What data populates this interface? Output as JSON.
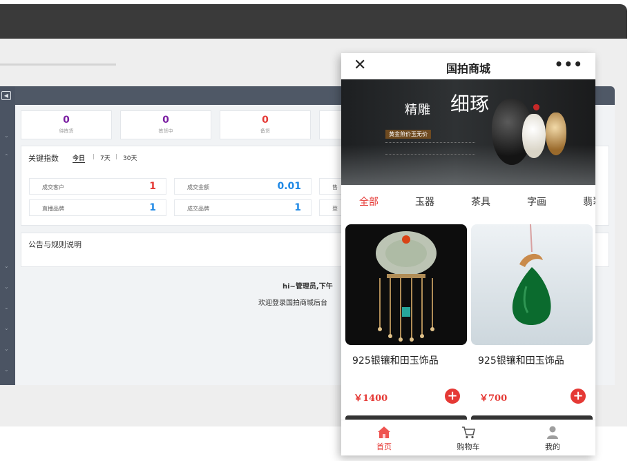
{
  "colors": {
    "accent": "#e53935",
    "sidebar": "#4b5463",
    "highlight_blue": "#1e88e5",
    "purple": "#7b1fa2"
  },
  "admin": {
    "stats": [
      {
        "value": "0",
        "label": "待拣货",
        "color": "#7b1fa2"
      },
      {
        "value": "0",
        "label": "拣货中",
        "color": "#7b1fa2"
      },
      {
        "value": "0",
        "label": "备货",
        "color": "#e53935"
      }
    ],
    "key_index": {
      "title": "关键指数",
      "ranges": [
        "今日",
        "7天",
        "30天"
      ],
      "separator": "|",
      "metrics": [
        {
          "label": "成交客户",
          "value": "1",
          "color": "#e53935"
        },
        {
          "label": "成交金额",
          "value": "0.01",
          "color": "#1e88e5"
        },
        {
          "label": "直播品牌",
          "value": "1",
          "color": "#1e88e5"
        },
        {
          "label": "成交品牌",
          "value": "1",
          "color": "#1e88e5"
        }
      ],
      "partial_labels": [
        "售",
        "登"
      ]
    },
    "notice": {
      "title": "公告与规则说明"
    },
    "welcome": {
      "line1": "hi~管理员,下午",
      "line2": "欢迎登录国拍商城后台"
    }
  },
  "mini_app": {
    "title": "国拍商城",
    "close_icon": "close-icon",
    "more_icon": "more-icon",
    "banner": {
      "brush_text": "精雕",
      "brush_big": "细琢",
      "tag": "黄金煎价玉无价"
    },
    "categories": [
      {
        "label": "全部",
        "active": true
      },
      {
        "label": "玉器",
        "active": false
      },
      {
        "label": "茶具",
        "active": false
      },
      {
        "label": "字画",
        "active": false
      },
      {
        "label": "翡翠",
        "active": false
      }
    ],
    "products": [
      {
        "name": "925银镶和田玉饰品",
        "price": "￥1400",
        "add": "+"
      },
      {
        "name": "925银镶和田玉饰品",
        "price": "￥700",
        "add": "+"
      }
    ],
    "tabs": [
      {
        "label": "首页",
        "icon": "home-icon",
        "active": true
      },
      {
        "label": "购物车",
        "icon": "cart-icon",
        "active": false
      },
      {
        "label": "我的",
        "icon": "user-icon",
        "active": false
      }
    ]
  }
}
